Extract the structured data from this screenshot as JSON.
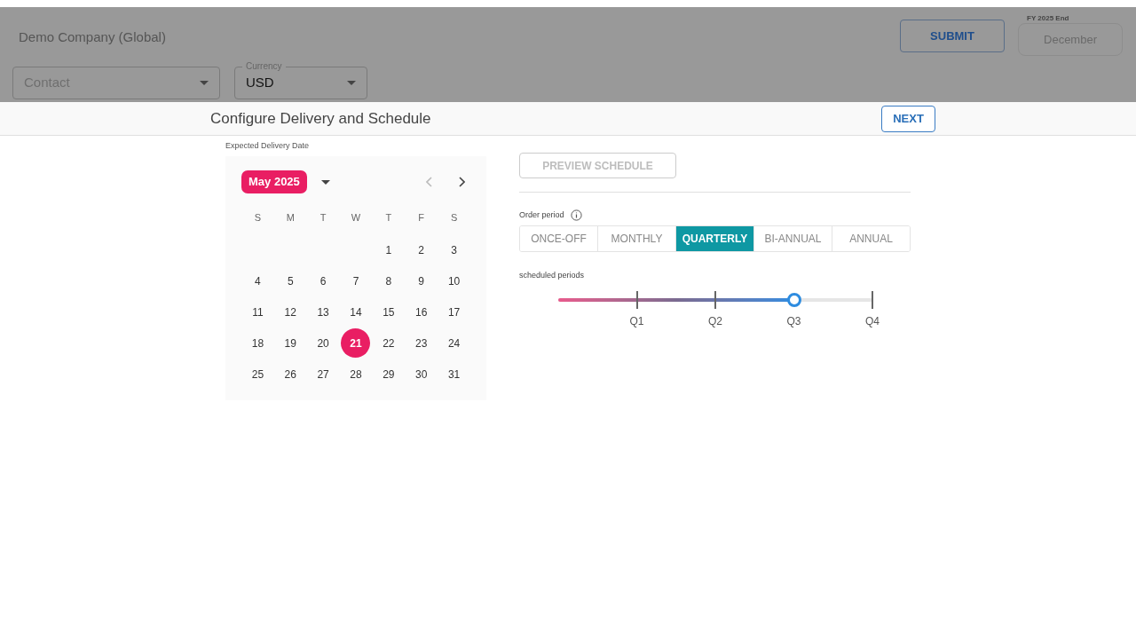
{
  "header": {
    "company": "Demo Company (Global)",
    "contact": {
      "placeholder": "Contact"
    },
    "currency": {
      "label": "Currency",
      "value": "USD"
    },
    "submit": "SUBMIT",
    "fiscal_year": {
      "label": "FY 2025 End",
      "value": "December"
    }
  },
  "toolbar": {
    "title": "Configure Delivery and Schedule",
    "next": "NEXT"
  },
  "calendar": {
    "label": "Expected Delivery Date",
    "month": "May 2025",
    "weekdays": [
      "S",
      "M",
      "T",
      "W",
      "T",
      "F",
      "S"
    ],
    "weeks": [
      [
        {
          "label": "1",
          "selected": false
        },
        {
          "label": "2",
          "selected": false
        },
        {
          "label": "3",
          "selected": false
        }
      ],
      [
        {
          "label": "4",
          "selected": false
        },
        {
          "label": "5",
          "selected": false
        },
        {
          "label": "6",
          "selected": false
        },
        {
          "label": "7",
          "selected": false
        },
        {
          "label": "8",
          "selected": false
        },
        {
          "label": "9",
          "selected": false
        },
        {
          "label": "10",
          "selected": false
        }
      ],
      [
        {
          "label": "11",
          "selected": false
        },
        {
          "label": "12",
          "selected": false
        },
        {
          "label": "13",
          "selected": false
        },
        {
          "label": "14",
          "selected": false
        },
        {
          "label": "15",
          "selected": false
        },
        {
          "label": "16",
          "selected": false
        },
        {
          "label": "17",
          "selected": false
        }
      ],
      [
        {
          "label": "18",
          "selected": false
        },
        {
          "label": "19",
          "selected": false
        },
        {
          "label": "20",
          "selected": false
        },
        {
          "label": "21",
          "selected": true
        },
        {
          "label": "22",
          "selected": false
        },
        {
          "label": "23",
          "selected": false
        },
        {
          "label": "24",
          "selected": false
        }
      ],
      [
        {
          "label": "25",
          "selected": false
        },
        {
          "label": "26",
          "selected": false
        },
        {
          "label": "27",
          "selected": false
        },
        {
          "label": "28",
          "selected": false
        },
        {
          "label": "29",
          "selected": false
        },
        {
          "label": "30",
          "selected": false
        },
        {
          "label": "31",
          "selected": false
        }
      ]
    ]
  },
  "preview_button": {
    "label": "PREVIEW SCHEDULE",
    "disabled": true
  },
  "order_period": {
    "label": "Order period",
    "options": [
      {
        "label": "ONCE-OFF",
        "selected": false
      },
      {
        "label": "MONTHLY",
        "selected": false
      },
      {
        "label": "QUARTERLY",
        "selected": true
      },
      {
        "label": "BI-ANNUAL",
        "selected": false
      },
      {
        "label": "ANNUAL",
        "selected": false
      }
    ]
  },
  "scheduled_periods": {
    "label": "scheduled periods",
    "level": 0.75,
    "ticks": [
      "Q1",
      "Q2",
      "Q3",
      "Q4"
    ]
  }
}
